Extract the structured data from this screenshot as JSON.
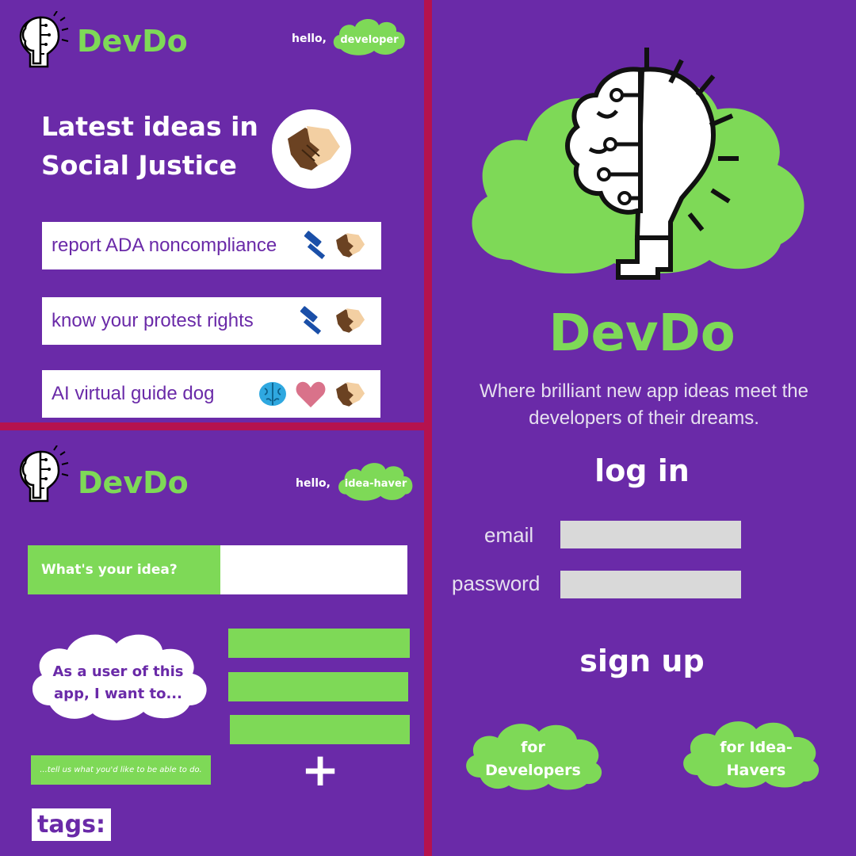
{
  "brand": {
    "name": "DevDo",
    "tagline": "Where brilliant new app ideas meet the developers of their dreams."
  },
  "dev_screen": {
    "greeting": "hello,",
    "role": "developer",
    "heading_line1": "Latest ideas in",
    "heading_line2": "Social Justice",
    "ideas": [
      {
        "title": "report ADA noncompliance",
        "icons": [
          "gavel-icon",
          "handshake-icon"
        ]
      },
      {
        "title": "know your protest rights",
        "icons": [
          "gavel-icon",
          "handshake-icon"
        ]
      },
      {
        "title": "AI virtual guide dog",
        "icons": [
          "brain-icon",
          "heart-icon",
          "handshake-icon"
        ]
      }
    ]
  },
  "idea_screen": {
    "greeting": "hello,",
    "role": "idea-haver",
    "prompt": "What's your idea?",
    "cloud_text": "As a user of this app, I want to...",
    "hint": "...tell us what you'd like to be able to do.",
    "add_symbol": "+",
    "tags_label": "tags:"
  },
  "login": {
    "title": "log in",
    "email_label": "email",
    "password_label": "password",
    "signup_title": "sign up",
    "for_developers": "for Developers",
    "for_idea_havers": "for Idea-Havers"
  },
  "colors": {
    "background": "#6a2aa8",
    "accent": "#7ed957",
    "divider": "#b5124e"
  }
}
